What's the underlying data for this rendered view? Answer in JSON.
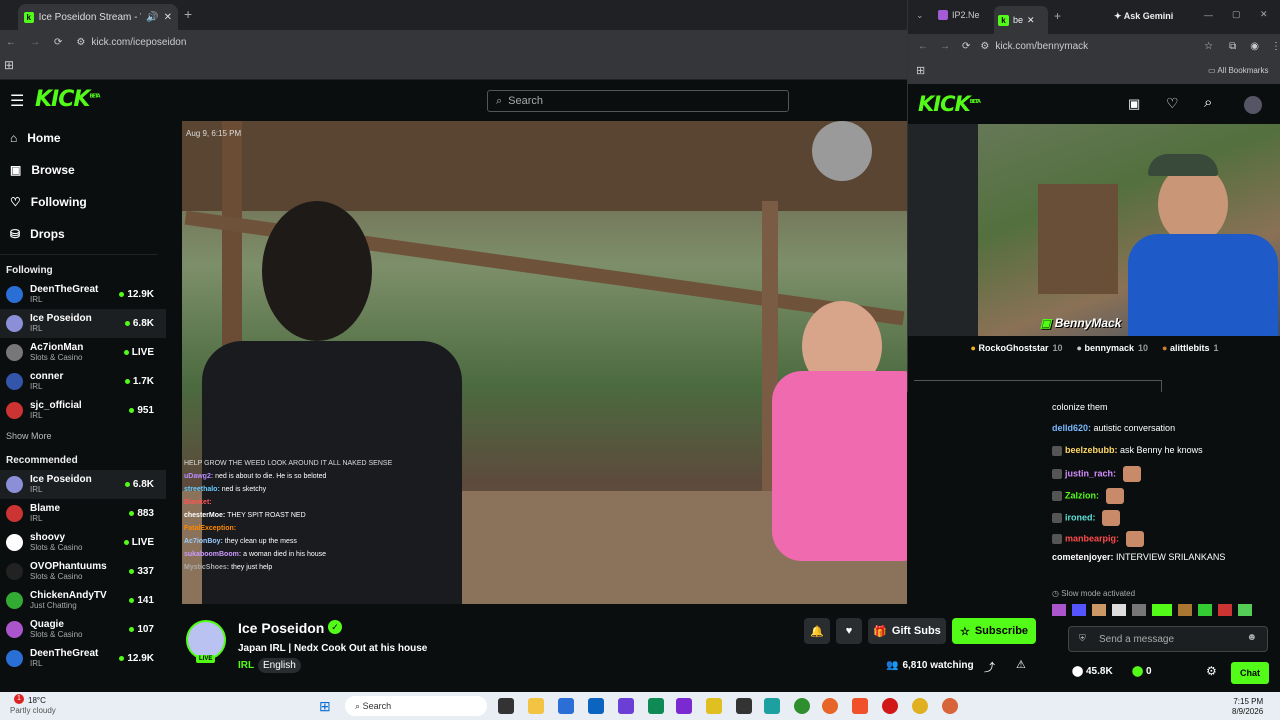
{
  "left_browser": {
    "tab_title": "Ice Poseidon Stream - Wat",
    "url": "kick.com/iceposeidon"
  },
  "kick": {
    "logo": "KICK",
    "logo_badge": "BETA",
    "search_placeholder": "Search",
    "nav": [
      {
        "label": "Home",
        "icon": "home-icon"
      },
      {
        "label": "Browse",
        "icon": "browse-icon"
      },
      {
        "label": "Following",
        "icon": "heart-icon"
      },
      {
        "label": "Drops",
        "icon": "drops-icon"
      }
    ],
    "following_label": "Following",
    "following": [
      {
        "name": "DeenTheGreat",
        "category": "IRL",
        "viewers": "12.9K",
        "color": "#2a6fd6"
      },
      {
        "name": "Ice Poseidon",
        "category": "IRL",
        "viewers": "6.8K",
        "color": "#8a8fd8"
      },
      {
        "name": "Ac7ionMan",
        "category": "Slots & Casino",
        "viewers": "LIVE",
        "color": "#777"
      },
      {
        "name": "conner",
        "category": "IRL",
        "viewers": "1.7K",
        "color": "#3355aa"
      },
      {
        "name": "sjc_official",
        "category": "IRL",
        "viewers": "951",
        "color": "#c33"
      }
    ],
    "show_more": "Show More",
    "recommended_label": "Recommended",
    "recommended": [
      {
        "name": "Ice Poseidon",
        "category": "IRL",
        "viewers": "6.8K",
        "color": "#8a8fd8"
      },
      {
        "name": "Blame",
        "category": "IRL",
        "viewers": "883",
        "color": "#c33"
      },
      {
        "name": "shoovy",
        "category": "Slots & Casino",
        "viewers": "LIVE",
        "color": "#fff"
      },
      {
        "name": "OVOPhantuums",
        "category": "Slots & Casino",
        "viewers": "337",
        "color": "#222"
      },
      {
        "name": "ChickenAndyTV",
        "category": "Just Chatting",
        "viewers": "141",
        "color": "#3a3"
      },
      {
        "name": "Quagie",
        "category": "Slots & Casino",
        "viewers": "107",
        "color": "#a5c"
      },
      {
        "name": "DeenTheGreat",
        "category": "IRL",
        "viewers": "12.9K",
        "color": "#2a6fd6"
      }
    ]
  },
  "video": {
    "timestamp": "Aug 9, 6:15 PM",
    "overlay_top": "HELP GROW THE WEED LOOK AROUND IT ALL NAKED SENSE",
    "overlay_chat": [
      {
        "user": "uDawg2:",
        "msg": "ned is about to die. He is so beloted",
        "color": "#b88cff"
      },
      {
        "user": "streethalo:",
        "msg": "ned is sketchy",
        "color": "#6cf"
      },
      {
        "user": "Blanket:",
        "msg": "",
        "color": "#f55"
      },
      {
        "user": "chesterMoe:",
        "msg": "THEY SPIT ROAST NED",
        "color": "#fff"
      },
      {
        "user": "FatalException:",
        "msg": "",
        "color": "#f80"
      },
      {
        "user": "Ac7ionBoy:",
        "msg": "they clean up the mess",
        "color": "#9cf"
      },
      {
        "user": "sukaboomBoom:",
        "msg": "a woman died in his house",
        "color": "#c9f"
      },
      {
        "user": "MysticShoes:",
        "msg": "they just help",
        "color": "#aaa"
      }
    ]
  },
  "channel": {
    "name": "Ice Poseidon",
    "title": "Japan IRL | Nedx Cook Out at his house",
    "tags": [
      "IRL",
      "English"
    ],
    "live_badge": "LIVE",
    "gift_label": "Gift Subs",
    "subscribe_label": "Subscribe",
    "watching": "6,810 watching"
  },
  "right_browser": {
    "tabs": [
      "IP2.Ne",
      "be"
    ],
    "ask": "Ask Gemini",
    "url": "kick.com/bennymack",
    "bookmarks": "All Bookmarks",
    "overlay_name": "BennyMack",
    "leaderboard": [
      {
        "name": "RockoGhoststar",
        "count": "10",
        "color": "#f0b020"
      },
      {
        "name": "bennymack",
        "count": "10",
        "color": "#ccc"
      },
      {
        "name": "alittlebits",
        "count": "1",
        "color": "#cd7f32"
      }
    ]
  },
  "chat": {
    "messages": [
      {
        "user": "",
        "msg": "colonize them",
        "color": "#fff"
      },
      {
        "user": "delld620:",
        "msg": "autistic conversation",
        "color": "#7ab8ff"
      },
      {
        "user": "beelzebubb:",
        "msg": "ask Benny he knows",
        "color": "#ffd966"
      },
      {
        "user": "justin_rach:",
        "msg": "",
        "color": "#d58cff"
      },
      {
        "user": "Zalzion:",
        "msg": "",
        "color": "#53fc18"
      },
      {
        "user": "ironed:",
        "msg": "",
        "color": "#5ce0d8"
      },
      {
        "user": "manbearpig:",
        "msg": "",
        "color": "#ff4b4b"
      },
      {
        "user": "cometenjoyer:",
        "msg": "INTERVIEW SRILANKANS",
        "color": "#fff"
      }
    ],
    "slow_mode": "Slow mode activated",
    "input_placeholder": "Send a message",
    "points": "45.8K",
    "kicks": "0",
    "chat_button": "Chat"
  },
  "taskbar": {
    "weather_temp": "18°C",
    "weather_desc": "Partly cloudy",
    "search": "Search",
    "time": "7:15 PM",
    "date": "8/9/2026"
  }
}
